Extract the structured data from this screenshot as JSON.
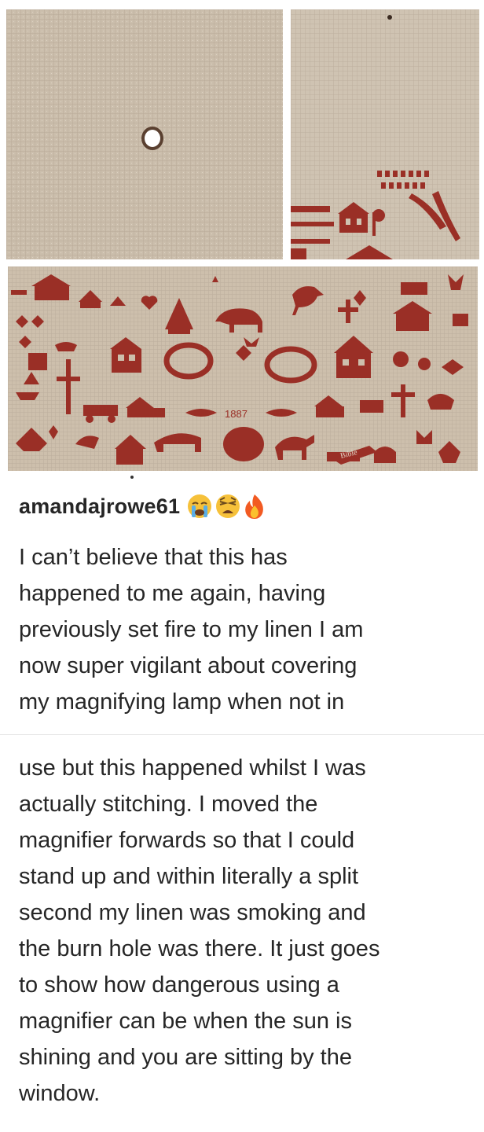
{
  "post": {
    "username": "amandajrowe61",
    "emojis": [
      "crying-face-icon",
      "weary-face-icon",
      "fire-icon"
    ],
    "caption_lines_top": [
      "I can’t believe that this has",
      "happened to me again, having",
      "previously set fire to my linen I am",
      "now super vigilant about covering",
      "my magnifying lamp when not in"
    ],
    "caption_lines_bottom": [
      "use but this happened whilst I was",
      "actually stitching. I moved the",
      "magnifier forwards so that I could",
      "stand up and within literally a split",
      "second my linen was smoking and",
      "the burn hole was there. It just goes",
      "to show how dangerous using a",
      "magnifier can be when the sun is",
      "shining and you are sitting by the",
      "window."
    ]
  },
  "images": {
    "sampler_year": "1887",
    "sampler_book_label": "Bible"
  },
  "colors": {
    "linen": "#cdbfac",
    "stitch_red": "#9a2f26",
    "text": "#262626"
  }
}
